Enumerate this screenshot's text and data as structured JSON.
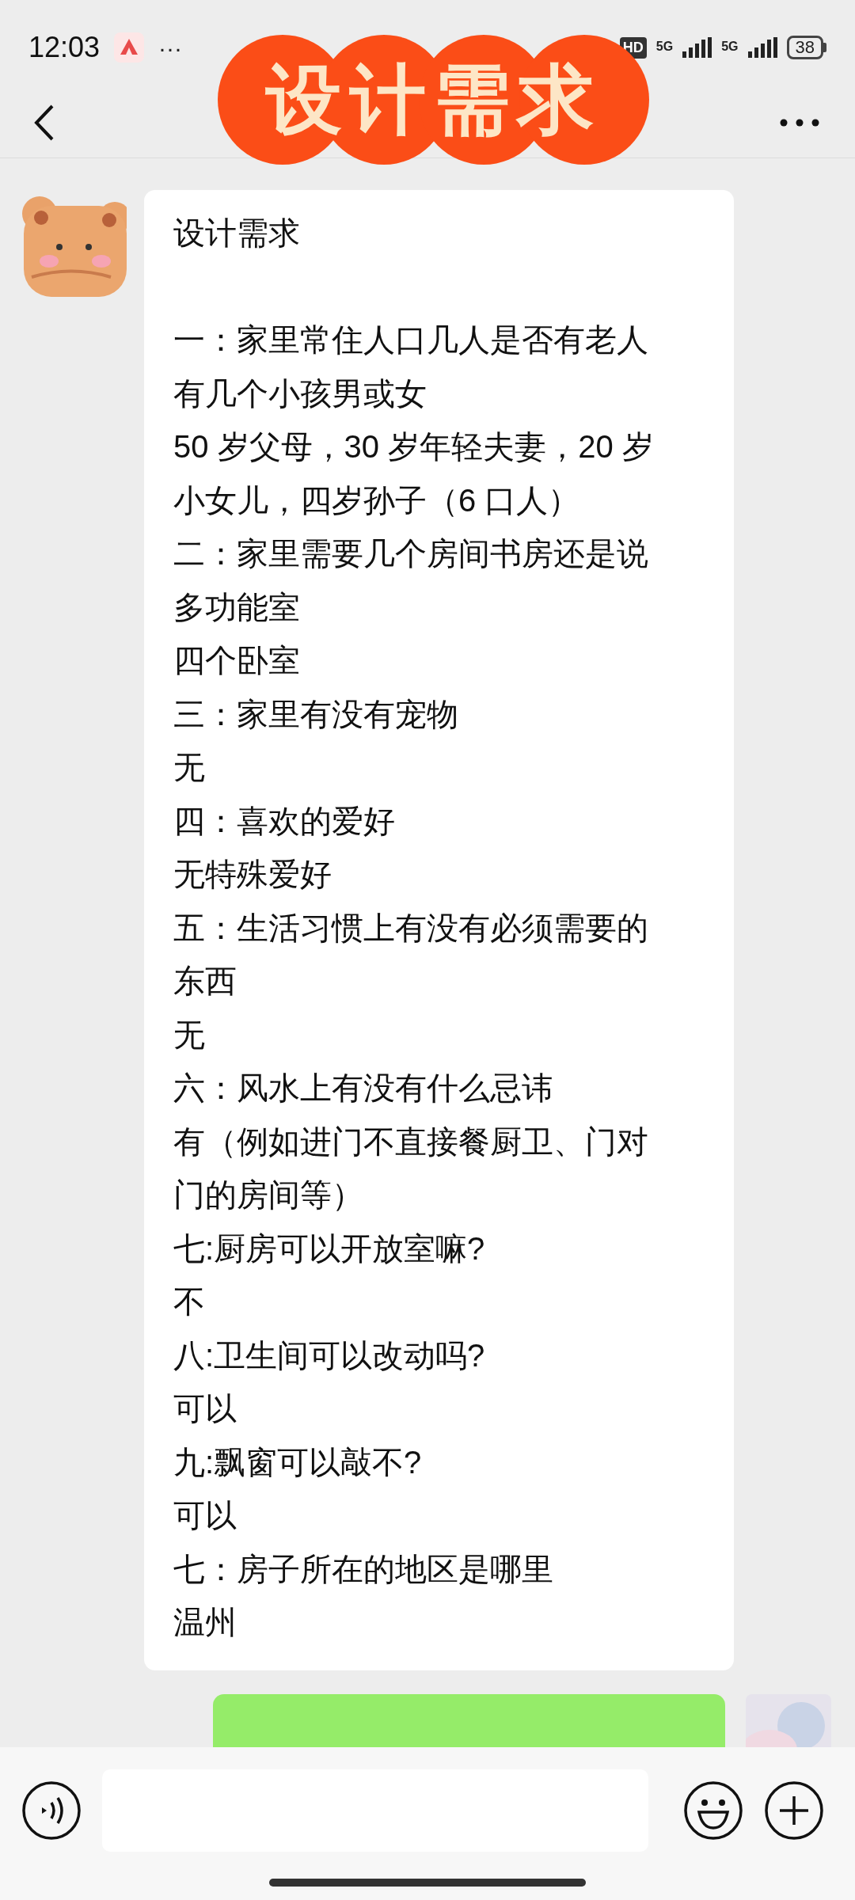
{
  "status_bar": {
    "time": "12:03",
    "more": "···",
    "hd": "HD",
    "networks": [
      "5G",
      "5G"
    ],
    "battery": "38"
  },
  "overlay_title": "设计需求",
  "message": {
    "title": "设计需求",
    "lines": [
      "一：家里常住人口几人是否有老人",
      "有几个小孩男或女",
      "50 岁父母，30 岁年轻夫妻，20 岁",
      "小女儿，四岁孙子（6 口人）",
      "二：家里需要几个房间书房还是说",
      "多功能室",
      "四个卧室",
      "三：家里有没有宠物",
      "无",
      "四：喜欢的爱好",
      "无特殊爱好",
      "五：生活习惯上有没有必须需要的",
      "东西",
      "无",
      "六：风水上有没有什么忌讳",
      "有（例如进门不直接餐厨卫、门对",
      "门的房间等）",
      "七:厨房可以开放室嘛?",
      "不",
      "八:卫生间可以改动吗?",
      "可以",
      "九:飘窗可以敲不?",
      "可以",
      "七：房子所在的地区是哪里",
      "温州"
    ]
  }
}
